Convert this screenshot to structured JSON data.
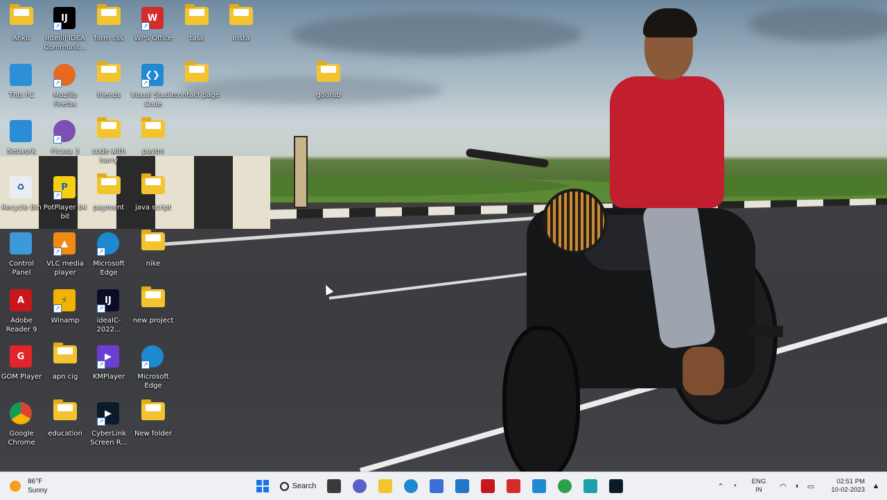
{
  "desktop_icons": [
    {
      "label": "Ankit",
      "type": "user-folder"
    },
    {
      "label": "IntelliJ IDEA Communit...",
      "type": "app",
      "color": "#000000",
      "glyph": "IJ"
    },
    {
      "label": "form css",
      "type": "folder"
    },
    {
      "label": "WPS Office",
      "type": "app",
      "color": "#d42b2b",
      "glyph": "W"
    },
    {
      "label": "task",
      "type": "folder"
    },
    {
      "label": "Insta",
      "type": "folder"
    },
    {
      "label": "This PC",
      "type": "app",
      "color": "#2d8fd6",
      "glyph": ""
    },
    {
      "label": "Mozilla Firefox",
      "type": "app",
      "color": "#e56a1f",
      "glyph": ""
    },
    {
      "label": "friends",
      "type": "folder"
    },
    {
      "label": "Visual Studio Code",
      "type": "app",
      "color": "#1f8ad2",
      "glyph": "❮❯"
    },
    {
      "label": "contact page",
      "type": "folder"
    },
    {
      "label": "gourab",
      "type": "folder"
    },
    {
      "label": "Network",
      "type": "app",
      "color": "#2a8bd6",
      "glyph": ""
    },
    {
      "label": "Picasa 3",
      "type": "app",
      "color": "#7b4fb4",
      "glyph": ""
    },
    {
      "label": "code with harry",
      "type": "folder"
    },
    {
      "label": "paytm",
      "type": "folder"
    },
    {
      "label": "Recycle Bin",
      "type": "app",
      "color": "#e9eef2",
      "glyph": "♻"
    },
    {
      "label": "PotPlayer 64 bit",
      "type": "app",
      "color": "#f6cf12",
      "glyph": "P"
    },
    {
      "label": "payment",
      "type": "folder"
    },
    {
      "label": "java script",
      "type": "folder"
    },
    {
      "label": "Control Panel",
      "type": "app",
      "color": "#3d9ad8",
      "glyph": ""
    },
    {
      "label": "VLC media player",
      "type": "app",
      "color": "#f08a12",
      "glyph": "▲"
    },
    {
      "label": "Microsoft Edge",
      "type": "app",
      "color": "#1d8ad0",
      "glyph": ""
    },
    {
      "label": "nike",
      "type": "folder"
    },
    {
      "label": "Adobe Reader 9",
      "type": "app",
      "color": "#c8161d",
      "glyph": "A"
    },
    {
      "label": "Winamp",
      "type": "app",
      "color": "#f2b300",
      "glyph": "⚡"
    },
    {
      "label": "ideaIC-2022...",
      "type": "app",
      "color": "#0c0c2a",
      "glyph": "IJ"
    },
    {
      "label": "new project",
      "type": "folder"
    },
    {
      "label": "GOM Player",
      "type": "app",
      "color": "#e3242b",
      "glyph": "G"
    },
    {
      "label": "apn cig",
      "type": "folder"
    },
    {
      "label": "KMPlayer",
      "type": "app",
      "color": "#6a3fd0",
      "glyph": "▶"
    },
    {
      "label": "Microsoft Edge",
      "type": "app",
      "color": "#1d8ad0",
      "glyph": ""
    },
    {
      "label": "Google Chrome",
      "type": "app",
      "color": "#ffffff",
      "glyph": ""
    },
    {
      "label": "education",
      "type": "folder"
    },
    {
      "label": "CyberLink Screen R...",
      "type": "app",
      "color": "#0c1a2a",
      "glyph": "▶"
    },
    {
      "label": "New folder",
      "type": "folder"
    }
  ],
  "taskbar": {
    "weather": {
      "temp": "86°F",
      "condition": "Sunny"
    },
    "search_label": "Search",
    "pinned": [
      {
        "name": "start-icon",
        "color": "#1a73e8"
      },
      {
        "name": "task-view-icon",
        "color": "#3a3a3a"
      },
      {
        "name": "chat-icon",
        "color": "#5b5fc7"
      },
      {
        "name": "file-explorer-icon",
        "color": "#f4c430"
      },
      {
        "name": "edge-icon",
        "color": "#1d8ad0"
      },
      {
        "name": "pen-app-icon",
        "color": "#3b6fd6"
      },
      {
        "name": "store-icon",
        "color": "#2476c6"
      },
      {
        "name": "mcafee-icon",
        "color": "#c8161d"
      },
      {
        "name": "wps-icon",
        "color": "#d42b2b"
      },
      {
        "name": "vscode-icon",
        "color": "#1f8ad2"
      },
      {
        "name": "chrome-icon",
        "color": "#2fa04a"
      },
      {
        "name": "app-teal-icon",
        "color": "#1aa0a8"
      },
      {
        "name": "pycharm-icon",
        "color": "#0c1a2a"
      }
    ],
    "tray": {
      "lang_line1": "ENG",
      "lang_line2": "IN",
      "time": "02:51 PM",
      "date": "10-02-2023"
    }
  }
}
